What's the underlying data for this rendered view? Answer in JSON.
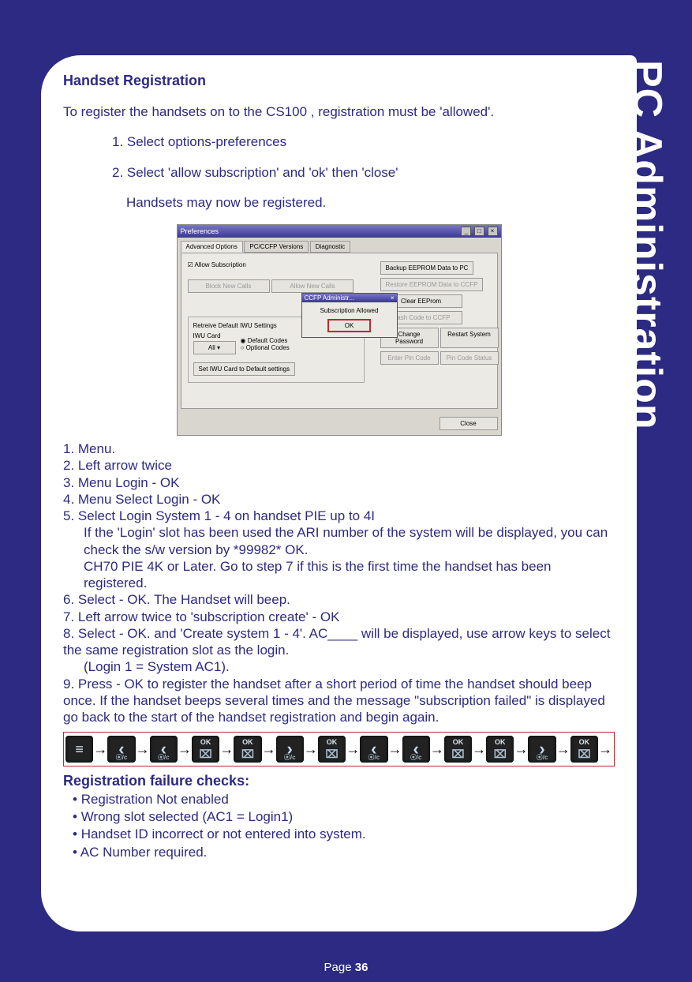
{
  "side_tab": "PC Administration",
  "footer": {
    "label": "Page ",
    "num": "36"
  },
  "title": "Handset Registration",
  "intro": "To register the handsets on to the CS100 , registration must be 'allowed'.",
  "intro_steps": [
    "1. Select options-preferences",
    "2. Select 'allow subscription' and 'ok' then 'close'",
    "Handsets may now be registered."
  ],
  "prefs": {
    "title": "Preferences",
    "tabs": [
      "Advanced Options",
      "PC/CCFP Versions",
      "Diagnostic"
    ],
    "allow_sub": "Allow Subscription",
    "block_new": "Block New Calls",
    "allow_new": "Allow New Calls",
    "retrieve": "Retreive Default IWU Settings",
    "iwu_card": "IWU Card",
    "iwu_val": "All",
    "radio1": "Default Codes",
    "radio2": "Optional Codes",
    "set_default": "Set IWU Card to Default settings",
    "backup": "Backup EEPROM Data to PC",
    "restore": "Restore EEPROM Data to CCFP",
    "clear": "Clear EEProm",
    "flash": "Flash Code to CCFP",
    "changepw": "Change Password",
    "restart": "Restart System",
    "enterpin": "Enter Pin Code",
    "pinstat": "Pin Code Status",
    "close": "Close",
    "dlg_title": "CCFP Administr...",
    "dlg_msg": "Subscription Allowed",
    "dlg_ok": "OK"
  },
  "steps": [
    "1. Menu.",
    "2. Left arrow twice",
    "3. Menu Login - OK",
    "4. Menu Select Login - OK",
    "5. Select Login System 1 - 4 on handset PIE up to 4I",
    "If the 'Login' slot has been used the ARI number of the system will be displayed, you can check the s/w version by  *99982* OK.",
    "CH70 PIE 4K or Later. Go to step 7 if this is the first time the handset has been registered.",
    "6. Select - OK. The Handset will beep.",
    "7. Left arrow twice to 'subscription create' - OK",
    "8. Select - OK. and 'Create system 1 - 4'. AC____ will be displayed, use arrow keys to select the same registration slot as the login.",
    "(Login 1 = System AC1).",
    "9. Press - OK to register the handset after a short period of time the handset should beep once. If the handset beeps several times and the message \"subscription failed\" is displayed go back to the start of the handset registration and begin again."
  ],
  "seq_keys": [
    "menu",
    "left",
    "left",
    "ok",
    "ok",
    "right",
    "ok",
    "left",
    "left",
    "ok",
    "ok",
    "right",
    "ok"
  ],
  "fail_title": "Registration failure checks:",
  "fail_checks": [
    "Registration Not enabled",
    "Wrong slot selected (AC1 = Login1)",
    "Handset ID incorrect or not entered into system.",
    "AC Number required."
  ]
}
